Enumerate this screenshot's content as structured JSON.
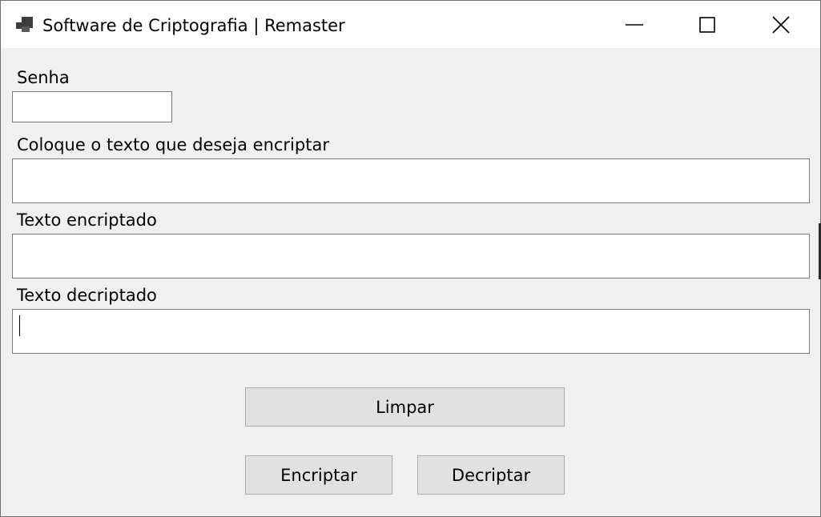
{
  "window": {
    "title": "Software de Criptografia | Remaster",
    "controls": {
      "minimize_icon": "minimize-icon",
      "maximize_icon": "maximize-icon",
      "close_icon": "close-icon"
    }
  },
  "form": {
    "password": {
      "label": "Senha",
      "value": ""
    },
    "plain_text": {
      "label": "Coloque o texto que deseja encriptar",
      "value": ""
    },
    "encrypted_text": {
      "label": "Texto encriptado",
      "value": ""
    },
    "decrypted_text": {
      "label": "Texto decriptado",
      "value": ""
    }
  },
  "buttons": {
    "clear": "Limpar",
    "encrypt": "Encriptar",
    "decrypt": "Decriptar"
  },
  "colors": {
    "window_bg": "#f0f0f0",
    "titlebar_bg": "#ffffff",
    "button_bg": "#e1e1e1",
    "button_border": "#adadad",
    "field_border": "#7a7a7a"
  }
}
